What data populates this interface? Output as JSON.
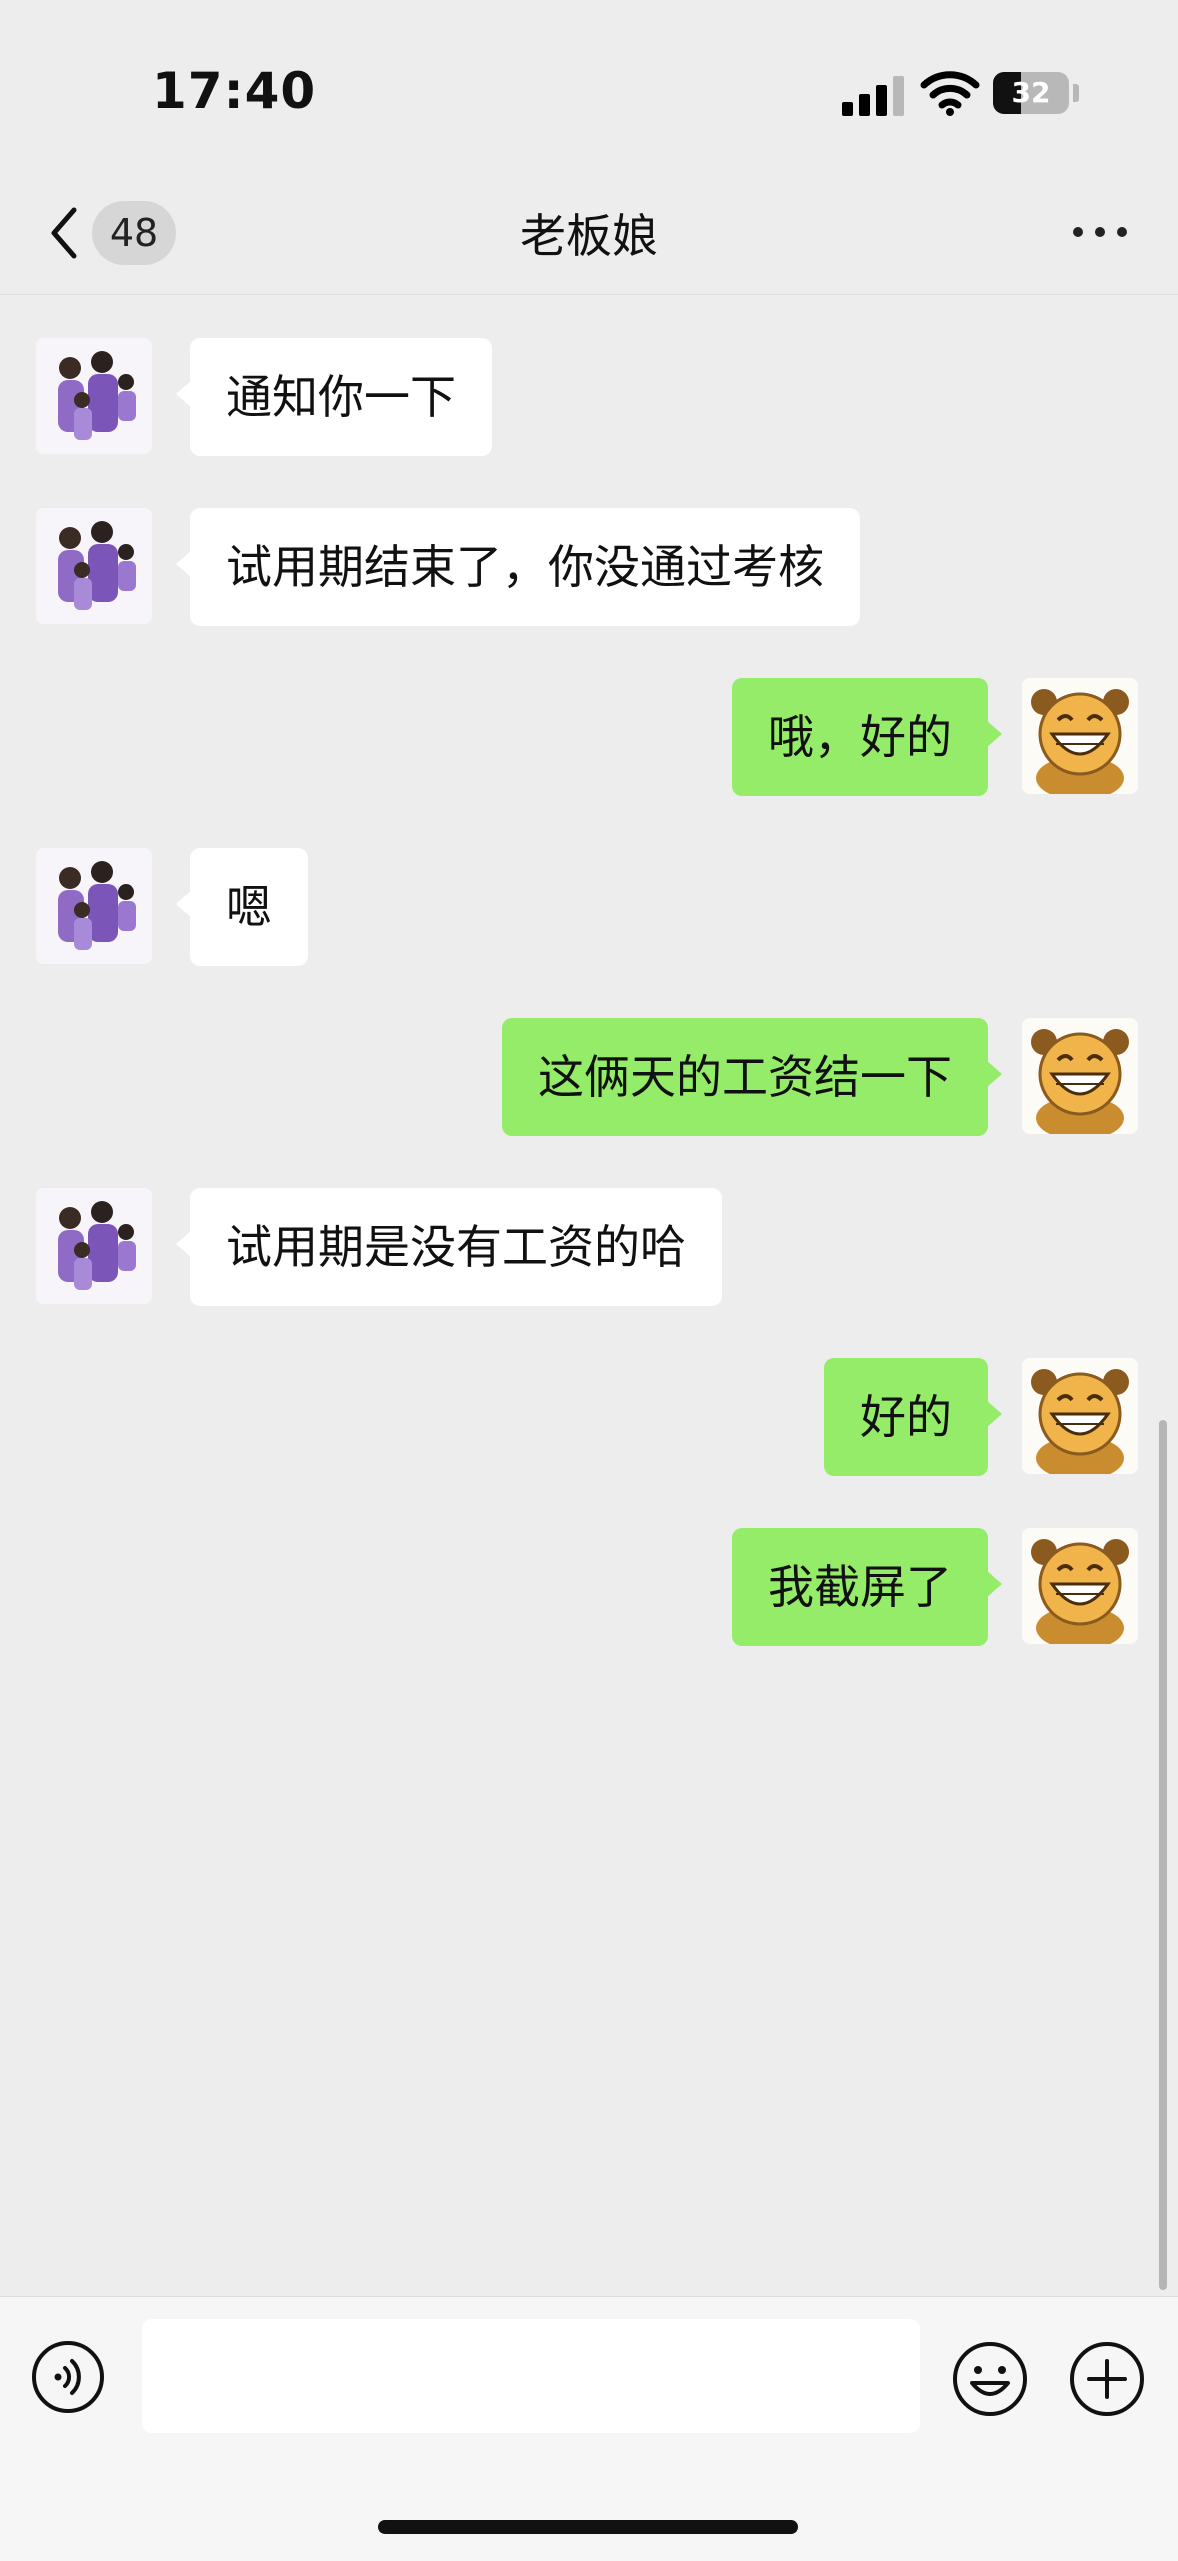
{
  "status_bar": {
    "time": "17:40",
    "battery_level": "32",
    "signal_icon": "cellular-signal-icon",
    "wifi_icon": "wifi-icon"
  },
  "nav": {
    "back_icon": "chevron-left-icon",
    "unread_count": "48",
    "title": "老板娘",
    "more_icon": "more-dots-icon"
  },
  "messages": [
    {
      "side": "in",
      "text": "通知你一下"
    },
    {
      "side": "in",
      "text": "试用期结束了，你没通过考核"
    },
    {
      "side": "out",
      "text": "哦，好的"
    },
    {
      "side": "in",
      "text": "嗯"
    },
    {
      "side": "out",
      "text": "这俩天的工资结一下"
    },
    {
      "side": "in",
      "text": "试用期是没有工资的哈"
    },
    {
      "side": "out",
      "text": "好的"
    },
    {
      "side": "out",
      "text": "我截屏了"
    }
  ],
  "input_bar": {
    "voice_icon": "voice-icon",
    "input_value": "",
    "emoji_icon": "emoji-icon",
    "plus_icon": "plus-icon"
  },
  "colors": {
    "background": "#ededed",
    "incoming_bubble": "#ffffff",
    "outgoing_bubble": "#95ec69"
  }
}
